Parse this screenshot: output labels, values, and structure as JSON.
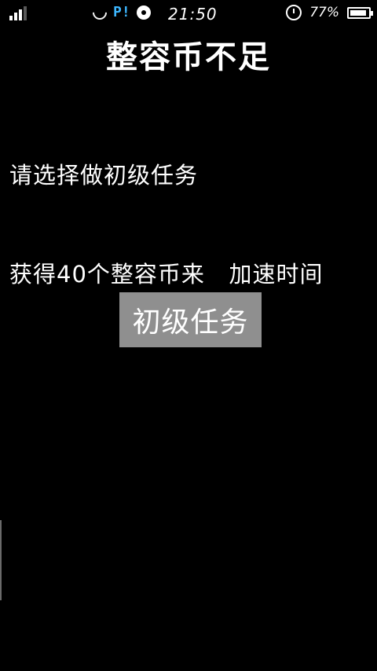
{
  "status_bar": {
    "time": "21:50",
    "battery_text": "77%",
    "battery_level": 0.77,
    "icons": [
      "signal-icon",
      "wifi-icon",
      "flag-icon",
      "disc-icon",
      "alarm-icon",
      "battery-icon"
    ]
  },
  "page": {
    "title": "整容币不足",
    "message_line1": "请选择做初级任务",
    "message_line2": "获得40个整容币来   加速时间",
    "primary_button_label": "初级任务"
  },
  "colors": {
    "background": "#000000",
    "text": "#ffffff",
    "button_bg": "#8f8f8f",
    "accent_blue": "#3db7ff"
  }
}
